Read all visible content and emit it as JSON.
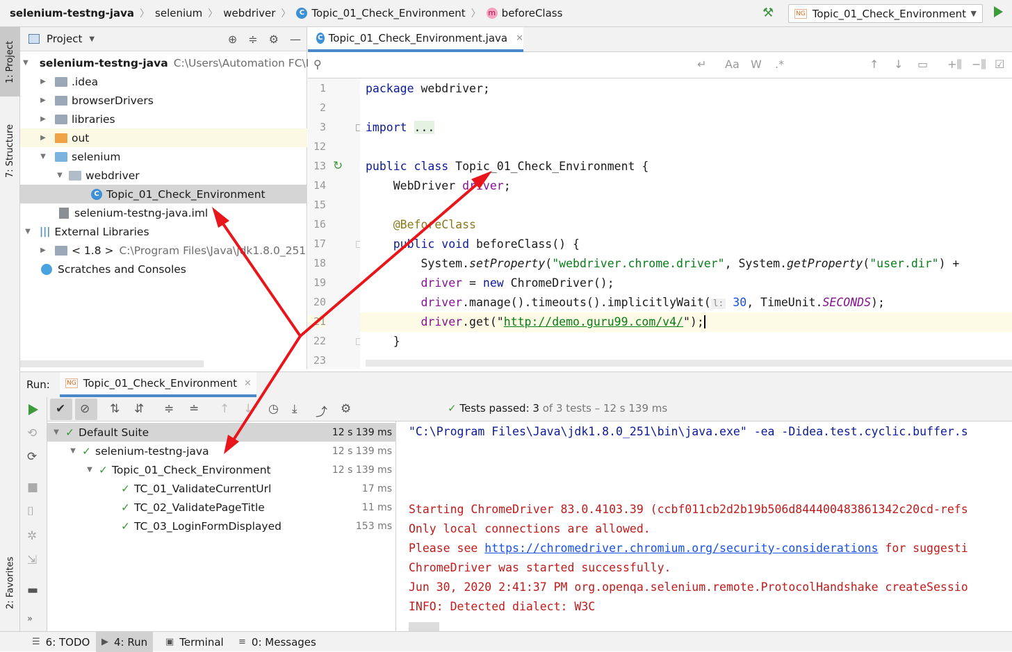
{
  "breadcrumb": {
    "items": [
      "selenium-testng-java",
      "selenium",
      "webdriver",
      "Topic_01_Check_Environment",
      "beforeClass"
    ]
  },
  "run_config": {
    "label": "Topic_01_Check_Environment"
  },
  "left_strip": {
    "project": "1: Project",
    "structure": "7: Structure",
    "favorites": "2: Favorites"
  },
  "project_panel": {
    "title": "Project",
    "tree": [
      {
        "label": "selenium-testng-java",
        "extra": "C:\\Users\\Automation FC\\Id"
      },
      {
        "label": ".idea"
      },
      {
        "label": "browserDrivers"
      },
      {
        "label": "libraries"
      },
      {
        "label": "out"
      },
      {
        "label": "selenium"
      },
      {
        "label": "webdriver"
      },
      {
        "label": "Topic_01_Check_Environment"
      },
      {
        "label": "selenium-testng-java.iml"
      },
      {
        "label": "External Libraries"
      },
      {
        "label": "< 1.8 >",
        "extra": "C:\\Program Files\\Java\\jdk1.8.0_251"
      },
      {
        "label": "Scratches and Consoles"
      }
    ]
  },
  "editor": {
    "tab_label": "Topic_01_Check_Environment.java",
    "line_numbers": [
      "1",
      "2",
      "3",
      "12",
      "13",
      "14",
      "15",
      "16",
      "17",
      "18",
      "19",
      "20",
      "21",
      "22",
      "23"
    ],
    "code": {
      "pkg_kw": "package",
      "pkg_name": " webdriver;",
      "import_kw": "import",
      "import_dots": "...",
      "cls_kw": "public class",
      "cls_name": " Topic_01_Check_Environment {",
      "field_type": "    WebDriver ",
      "field_name": "driver",
      "field_end": ";",
      "annotation": "    @BeforeClass",
      "method_kw": "    public void",
      "method_rest": " beforeClass() {",
      "l18_a": "        System.",
      "l18_b": "setProperty",
      "l18_c": "(",
      "l18_d": "\"webdriver.chrome.driver\"",
      "l18_e": ", System.",
      "l18_f": "getProperty",
      "l18_g": "(",
      "l18_h": "\"user.dir\"",
      "l18_i": ") +",
      "l19_a": "        ",
      "l19_b": "driver",
      "l19_c": " = ",
      "l19_d": "new",
      "l19_e": " ChromeDriver();",
      "l20_a": "        ",
      "l20_b": "driver",
      "l20_c": ".manage().timeouts().implicitlyWait(",
      "l20_hint": "l:",
      "l20_d": " 30",
      "l20_e": ", TimeUnit.",
      "l20_f": "SECONDS",
      "l20_g": ");",
      "l21_a": "        ",
      "l21_b": "driver",
      "l21_c": ".get(\"",
      "l21_url": "http://demo.guru99.com/v4/",
      "l21_d": "\");",
      "l22": "    }"
    }
  },
  "run_panel": {
    "run_label": "Run:",
    "tab_label": "Topic_01_Check_Environment",
    "status_prefix": "Tests passed:",
    "status_count": "3",
    "status_suffix": "of 3 tests – 12 s 139 ms",
    "tree": [
      {
        "label": "Default Suite",
        "time": "12 s 139 ms"
      },
      {
        "label": "selenium-testng-java",
        "time": "12 s 139 ms"
      },
      {
        "label": "Topic_01_Check_Environment",
        "time": "12 s 139 ms"
      },
      {
        "label": "TC_01_ValidateCurrentUrl",
        "time": "17 ms"
      },
      {
        "label": "TC_02_ValidatePageTitle",
        "time": "11 ms"
      },
      {
        "label": "TC_03_LoginFormDisplayed",
        "time": "153 ms"
      }
    ],
    "console": {
      "cmd": "\"C:\\Program Files\\Java\\jdk1.8.0_251\\bin\\java.exe\" -ea -Didea.test.cyclic.buffer.s",
      "l1": "Starting ChromeDriver 83.0.4103.39 (ccbf011cb2d2b19b506d844400483861342c20cd-refs",
      "l2": "Only local connections are allowed.",
      "l3_a": "Please see ",
      "l3_link": "https://chromedriver.chromium.org/security-considerations",
      "l3_b": " for suggesti",
      "l4": "ChromeDriver was started successfully.",
      "l5": "Jun 30, 2020 2:41:37 PM org.openqa.selenium.remote.ProtocolHandshake createSessio",
      "l6": "INFO: Detected dialect: W3C"
    }
  },
  "bottom_bar": {
    "todo": "6: TODO",
    "run": "4: Run",
    "terminal": "Terminal",
    "messages": "0: Messages"
  },
  "colors": {
    "accent": "#4a88c7",
    "success": "#3a9a3a",
    "annotation_arrow": "#e8161b"
  }
}
